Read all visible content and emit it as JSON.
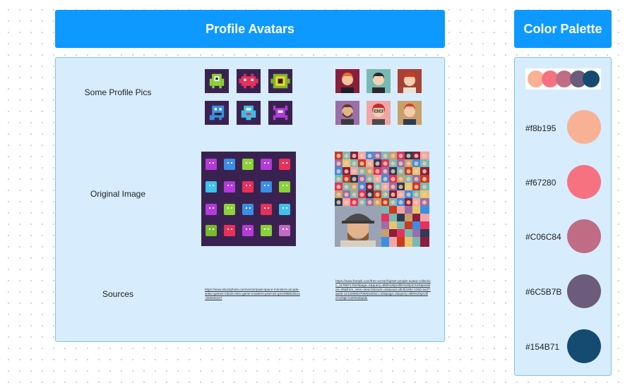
{
  "main": {
    "title": "Profile Avatars",
    "rows": {
      "profile_pics": "Some Profile Pics",
      "original_image": "Original Image",
      "sources": "Sources"
    },
    "sources": {
      "left": "https://www.istockphoto.com/vector/pixel-space-monsters-arcade-video-games-robots-retro-game-invaders-pixel-art-gm1096822614-294540107",
      "right": "https://www.freepik.com/free-vector/hipster-people-avatar-collection_1176871.htm#page=2&query=8bit%20profile%20pic%20&position=36&from_view=search&track=ais&uuid=d54b1681-126d-4a37-aad3-121448802706#position=34&page=2&query=8bit%20profile%20pic%20#editable"
    }
  },
  "palette": {
    "title": "Color Palette",
    "colors": [
      {
        "label": "#f8b195",
        "hex": "#f8b195"
      },
      {
        "label": "#f67280",
        "hex": "#f67280"
      },
      {
        "label": "#C06C84",
        "hex": "#C06C84"
      },
      {
        "label": "#6C5B7B",
        "hex": "#6C5B7B"
      },
      {
        "label": "#154B71",
        "hex": "#154B71"
      }
    ]
  },
  "icons": {
    "monsters": [
      "monster-green-icon",
      "monster-red-icon",
      "monster-eye-icon",
      "monster-blue-icon",
      "monster-cyan-icon",
      "monster-purple-icon"
    ],
    "people": [
      "avatar-orange-hair-icon",
      "avatar-dark-hair-icon",
      "avatar-red-hair-icon",
      "avatar-beard-icon",
      "avatar-glasses-icon",
      "avatar-red-hair-woman-icon"
    ]
  }
}
